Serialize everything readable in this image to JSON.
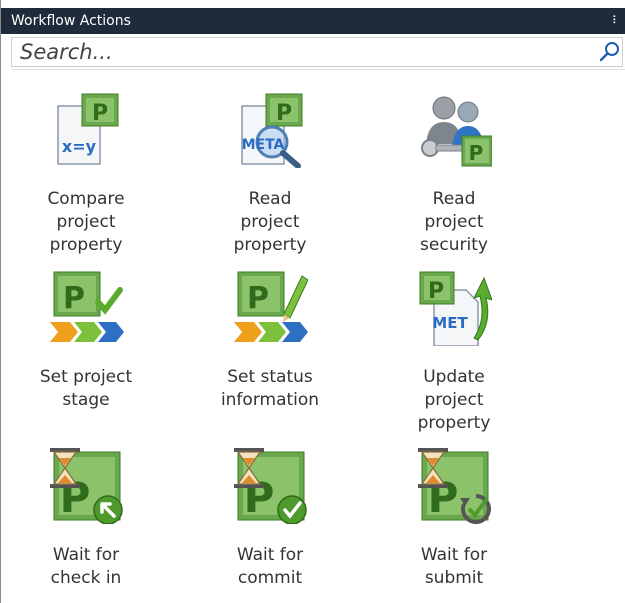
{
  "panel": {
    "title": "Workflow Actions",
    "grip": "⠇"
  },
  "search": {
    "placeholder": "Search..."
  },
  "actions": [
    {
      "label": "Compare\nproject\nproperty",
      "icon": "compare-property-icon"
    },
    {
      "label": "Read\nproject\nproperty",
      "icon": "read-property-icon"
    },
    {
      "label": "Read\nproject\nsecurity",
      "icon": "read-security-icon"
    },
    {
      "label": "Set project\nstage",
      "icon": "set-stage-icon"
    },
    {
      "label": "Set status\ninformation",
      "icon": "set-status-icon"
    },
    {
      "label": "Update\nproject\nproperty",
      "icon": "update-property-icon"
    },
    {
      "label": "Wait for\ncheck in",
      "icon": "wait-checkin-icon"
    },
    {
      "label": "Wait for\ncommit",
      "icon": "wait-commit-icon"
    },
    {
      "label": "Wait for\nsubmit",
      "icon": "wait-submit-icon"
    }
  ],
  "icon_text": {
    "equation": "x=y",
    "meta": "META",
    "meta_short": "MET",
    "project_letter": "P"
  },
  "colors": {
    "title_bar": "#1f2a3a",
    "project_green": "#6aa84f",
    "project_green_dark": "#3e7d22",
    "arrow_orange": "#f0a11c",
    "arrow_green": "#7cc13b",
    "arrow_blue": "#2d6fc2",
    "text_blue": "#2a6cc4"
  }
}
